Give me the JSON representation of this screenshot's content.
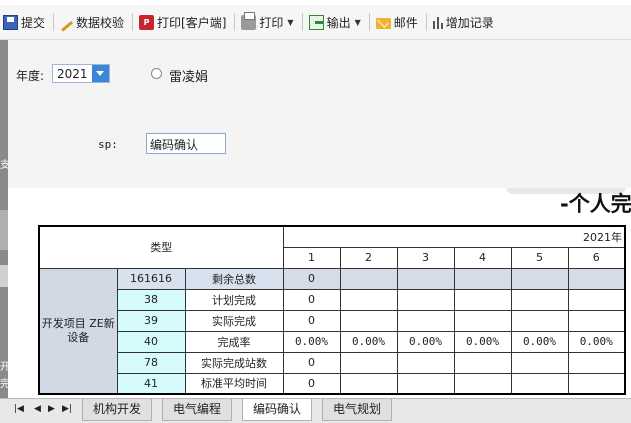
{
  "toolbar": {
    "submit": "提交",
    "validate": "数据校验",
    "print_client": "打印[客户端]",
    "print": "打印",
    "export": "输出",
    "mail": "邮件",
    "add_record": "增加记录"
  },
  "form": {
    "year_label": "年度:",
    "year_value": "2021",
    "radio_label": "雷凌娟",
    "sp_label": "sp:",
    "sp_value": "编码确认"
  },
  "left_strip": {
    "t1": "支",
    "t2": "开",
    "t3": "完"
  },
  "report": {
    "title": "-个人完",
    "type_header": "类型",
    "year_header": "2021年",
    "months": [
      "1",
      "2",
      "3",
      "4",
      "5",
      "6"
    ],
    "group_label": "开发项目 ZE新设备",
    "rows": [
      {
        "code": "161616",
        "name": "剩余总数",
        "values": [
          "0",
          "",
          "",
          "",
          "",
          ""
        ]
      },
      {
        "code": "38",
        "name": "计划完成",
        "values": [
          "0",
          "",
          "",
          "",
          "",
          ""
        ]
      },
      {
        "code": "39",
        "name": "实际完成",
        "values": [
          "0",
          "",
          "",
          "",
          "",
          ""
        ]
      },
      {
        "code": "40",
        "name": "完成率",
        "values": [
          "0.00%",
          "0.00%",
          "0.00%",
          "0.00%",
          "0.00%",
          "0.00%"
        ]
      },
      {
        "code": "78",
        "name": "实际完成站数",
        "values": [
          "0",
          "",
          "",
          "",
          "",
          ""
        ]
      },
      {
        "code": "41",
        "name": "标准平均时间",
        "values": [
          "0",
          "",
          "",
          "",
          "",
          ""
        ]
      }
    ]
  },
  "sheet_tabs": [
    "机构开发",
    "电气编程",
    "编码确认",
    "电气规划"
  ],
  "active_tab": 2
}
